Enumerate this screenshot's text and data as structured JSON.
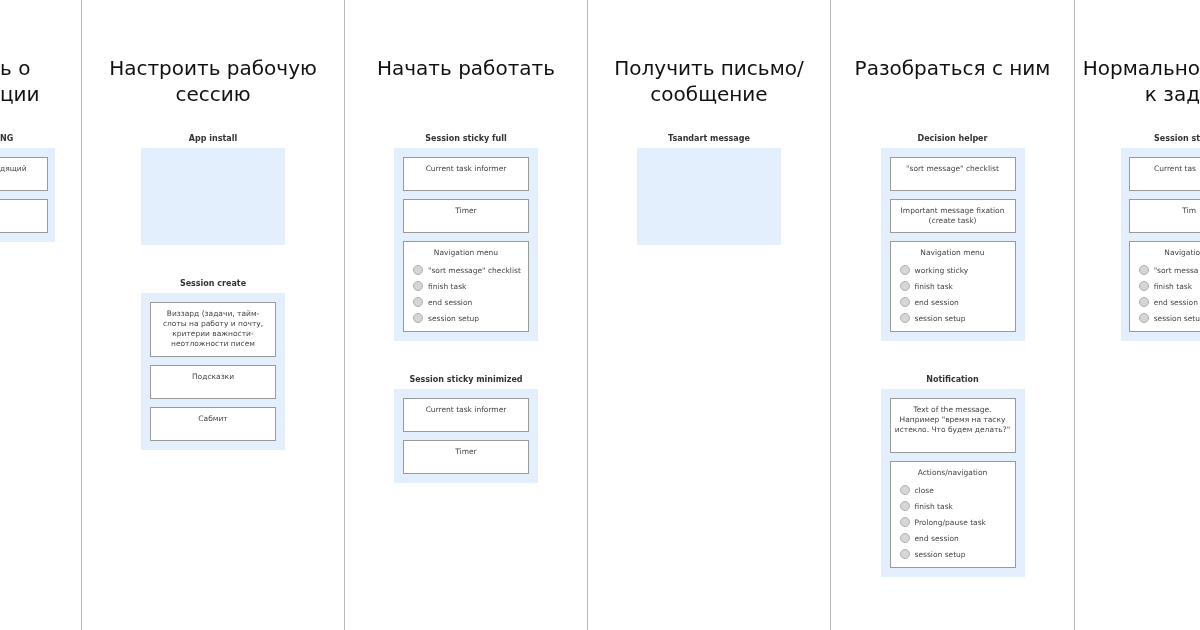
{
  "columns": [
    {
      "title_lines": [
        "ь о",
        "ции"
      ],
      "sections": [
        {
          "label": "NG",
          "kind": "panel",
          "blocks": [
            {
              "kind": "box",
              "text": "дящий"
            },
            {
              "kind": "box"
            }
          ]
        }
      ]
    },
    {
      "title_lines": [
        "Настроить рабочую",
        "сессию"
      ],
      "sections": [
        {
          "label": "App install",
          "kind": "placeholder"
        },
        {
          "label": "Session create",
          "kind": "panel",
          "blocks": [
            {
              "kind": "tall",
              "text": "Виззард (задачи, тайм-слоты на работу и почту, критерии важности-неотложности писем"
            },
            {
              "kind": "box",
              "text": "Подсказки"
            },
            {
              "kind": "box",
              "text": "Сабмит"
            }
          ]
        }
      ]
    },
    {
      "title_lines": [
        "Начать работать"
      ],
      "sections": [
        {
          "label": "Session sticky full",
          "kind": "panel",
          "blocks": [
            {
              "kind": "box",
              "text": "Current task informer"
            },
            {
              "kind": "box",
              "text": "Timer"
            },
            {
              "kind": "menu",
              "text": "Navigation menu",
              "items": [
                {
                  "label": "\"sort message\" checklist",
                  "selected": false
                },
                {
                  "label": "finish task",
                  "selected": false
                },
                {
                  "label": "end session",
                  "selected": false
                },
                {
                  "label": "session setup",
                  "selected": false
                }
              ]
            }
          ]
        },
        {
          "label": "Session sticky minimized",
          "kind": "panel",
          "blocks": [
            {
              "kind": "box",
              "text": "Current task informer"
            },
            {
              "kind": "box",
              "text": "Timer"
            }
          ]
        }
      ]
    },
    {
      "title_lines": [
        "Получить письмо/",
        "сообщение"
      ],
      "sections": [
        {
          "label": "Tsandart message",
          "kind": "placeholder"
        }
      ]
    },
    {
      "title_lines": [
        "Разобраться с ним"
      ],
      "sections": [
        {
          "label": "Decision helper",
          "kind": "panel",
          "blocks": [
            {
              "kind": "box",
              "text": "\"sort message\" checklist"
            },
            {
              "kind": "box",
              "text": "Important message fixation (create task)"
            },
            {
              "kind": "menu",
              "text": "Navigation menu",
              "items": [
                {
                  "label": "working sticky",
                  "selected": false
                },
                {
                  "label": "finish task",
                  "selected": false
                },
                {
                  "label": "end session",
                  "selected": false
                },
                {
                  "label": "session setup",
                  "selected": false
                }
              ]
            }
          ]
        },
        {
          "label": "Notification",
          "kind": "panel",
          "blocks": [
            {
              "kind": "tall",
              "text": "Text of the message. Например \"время на таску истекло. Что будем делать?\""
            },
            {
              "kind": "menu",
              "text": "Actions/navigation",
              "items": [
                {
                  "label": "close",
                  "selected": false
                },
                {
                  "label": "finish task",
                  "selected": false
                },
                {
                  "label": "Prolong/pause task",
                  "selected": false
                },
                {
                  "label": "end session",
                  "selected": false
                },
                {
                  "label": "session setup",
                  "selected": false
                }
              ]
            }
          ]
        }
      ]
    },
    {
      "title_lines": [
        "Нормально",
        "к зад"
      ],
      "sections": [
        {
          "label": "Session st",
          "kind": "panel",
          "blocks": [
            {
              "kind": "box",
              "text": "Current tas"
            },
            {
              "kind": "box",
              "text": "Tim"
            },
            {
              "kind": "menu",
              "text": "Navigatio",
              "items": [
                {
                  "label": "\"sort messa",
                  "selected": false
                },
                {
                  "label": "finish task",
                  "selected": false
                },
                {
                  "label": "end session",
                  "selected": false
                },
                {
                  "label": "session setu",
                  "selected": false
                }
              ]
            }
          ]
        }
      ]
    }
  ]
}
